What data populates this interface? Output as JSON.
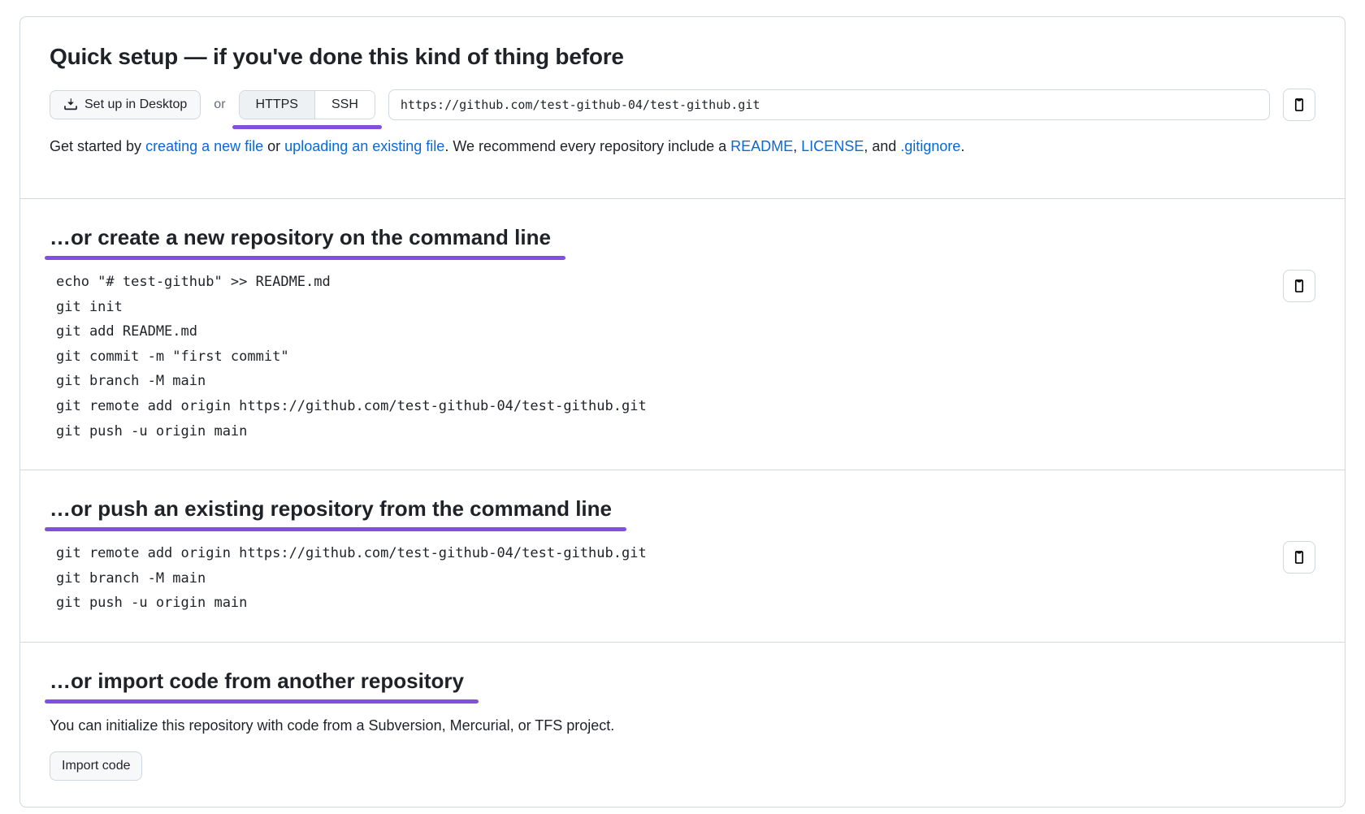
{
  "quick_setup": {
    "heading": "Quick setup — if you've done this kind of thing before",
    "desktop_button": "Set up in Desktop",
    "or_label": "or",
    "protocol_https": "HTTPS",
    "protocol_ssh": "SSH",
    "clone_url": "https://github.com/test-github-04/test-github.git",
    "hint_prefix": "Get started by ",
    "link_create_file": "creating a new file",
    "hint_or": " or ",
    "link_upload_file": "uploading an existing file",
    "hint_middle": ". We recommend every repository include a ",
    "link_readme": "README",
    "comma_sep": ", ",
    "link_license": "LICENSE",
    "hint_and": ", and ",
    "link_gitignore": ".gitignore",
    "hint_end": "."
  },
  "create_repo": {
    "heading": "…or create a new repository on the command line",
    "code": "echo \"# test-github\" >> README.md\ngit init\ngit add README.md\ngit commit -m \"first commit\"\ngit branch -M main\ngit remote add origin https://github.com/test-github-04/test-github.git\ngit push -u origin main"
  },
  "push_existing": {
    "heading": "…or push an existing repository from the command line",
    "code": "git remote add origin https://github.com/test-github-04/test-github.git\ngit branch -M main\ngit push -u origin main"
  },
  "import_code": {
    "heading": "…or import code from another repository",
    "description": "You can initialize this repository with code from a Subversion, Mercurial, or TFS project.",
    "button": "Import code"
  }
}
